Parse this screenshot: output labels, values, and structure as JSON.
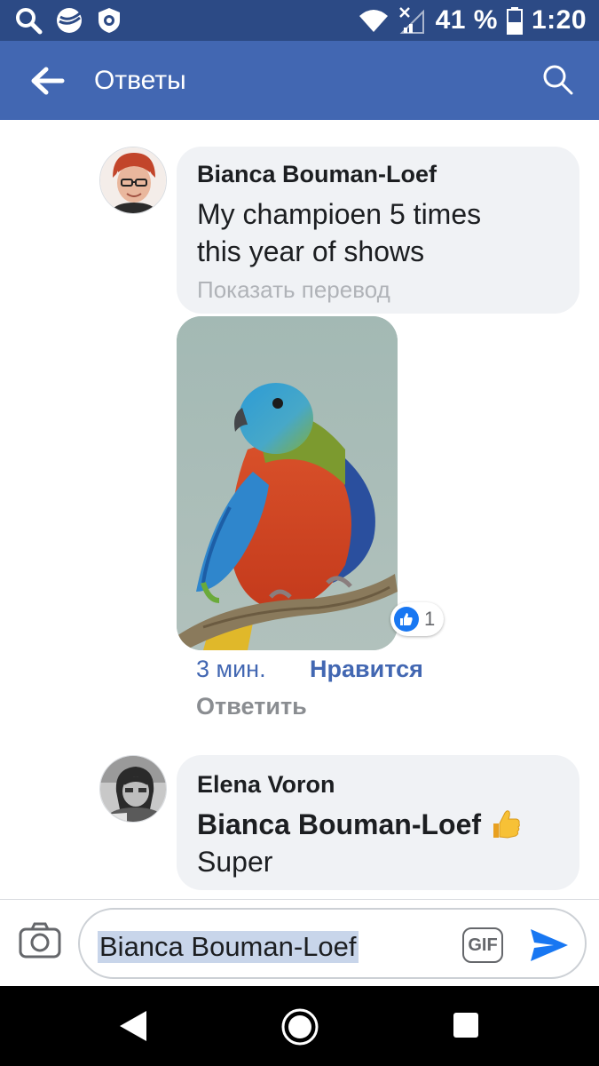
{
  "status_bar": {
    "battery_percent": "41 %",
    "time": "1:20"
  },
  "header": {
    "title": "Ответы"
  },
  "comments": [
    {
      "author": "Bianca Bouman-Loef",
      "text_lines": [
        "My champioen 5 times",
        "this year of shows"
      ],
      "translate_label": "Показать перевод",
      "reaction_count": "1",
      "time": "3 мин.",
      "like_label": "Нравится",
      "reply_label": "Ответить"
    },
    {
      "author": "Elena Voron",
      "mention": "Bianca Bouman-Loef",
      "text": "Super"
    }
  ],
  "composer": {
    "input_value": "Bianca Bouman-Loef",
    "gif_label": "GIF"
  },
  "colors": {
    "header": "#4267b2",
    "status_bar": "#2c4a85",
    "link": "#4267b2",
    "bubble": "#f0f2f5"
  }
}
